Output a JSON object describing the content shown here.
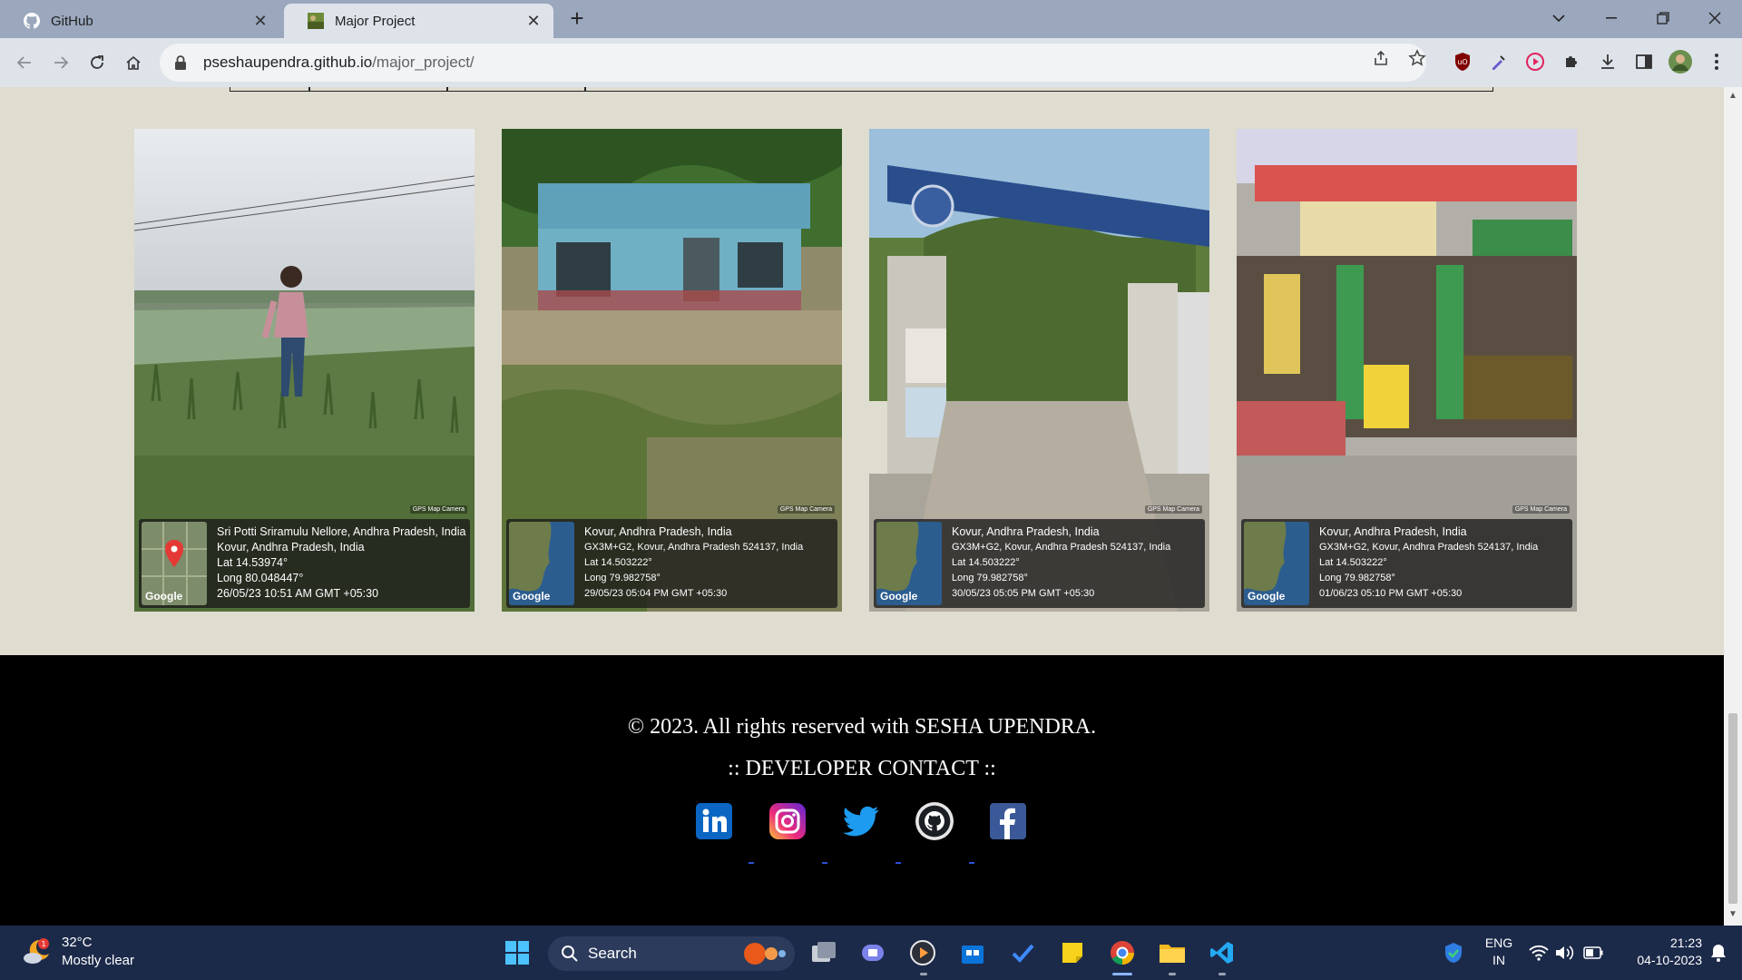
{
  "browser": {
    "tabs": [
      {
        "title": "GitHub",
        "active": false
      },
      {
        "title": "Major Project",
        "active": true
      }
    ],
    "url_host": "pseshaupendra.github.io",
    "url_path": "/major_project/"
  },
  "photos": [
    {
      "line1": "Sri Potti Sriramulu Nellore, Andhra Pradesh, India",
      "line2": "Kovur, Andhra Pradesh, India",
      "line3": "Lat 14.53974°",
      "line4": "Long 80.048447°",
      "line5": "26/05/23 10:51 AM GMT +05:30"
    },
    {
      "line1": "Kovur, Andhra Pradesh, India",
      "line2": "GX3M+G2, Kovur, Andhra Pradesh 524137, India",
      "line3": "Lat 14.503222°",
      "line4": "Long 79.982758°",
      "line5": "29/05/23 05:04 PM GMT +05:30"
    },
    {
      "line1": "Kovur, Andhra Pradesh, India",
      "line2": "GX3M+G2, Kovur, Andhra Pradesh 524137, India",
      "line3": "Lat 14.503222°",
      "line4": "Long 79.982758°",
      "line5": "30/05/23 05:05 PM GMT +05:30"
    },
    {
      "line1": "Kovur, Andhra Pradesh, India",
      "line2": "GX3M+G2, Kovur, Andhra Pradesh 524137, India",
      "line3": "Lat 14.503222°",
      "line4": "Long 79.982758°",
      "line5": "01/06/23 05:10 PM GMT +05:30"
    }
  ],
  "stamp": {
    "map_label": "Google",
    "camera_label": "GPS Map Camera"
  },
  "footer": {
    "copyright": "© 2023. All rights reserved with SESHA UPENDRA.",
    "contact_heading": ":: DEVELOPER CONTACT ::",
    "social": [
      "linkedin-icon",
      "instagram-icon",
      "twitter-icon",
      "github-icon",
      "facebook-icon"
    ]
  },
  "taskbar": {
    "temperature": "32°C",
    "weather": "Mostly clear",
    "weather_badge": "1",
    "search_label": "Search",
    "lang_line1": "ENG",
    "lang_line2": "IN",
    "time": "21:23",
    "date": "04-10-2023"
  }
}
